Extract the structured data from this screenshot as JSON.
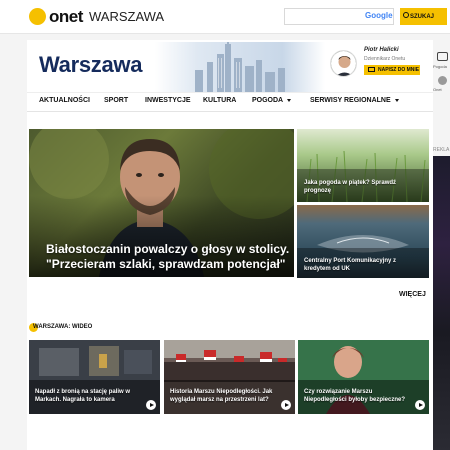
{
  "header": {
    "brand": "onet",
    "section": "WARSZAWA",
    "search": {
      "placeholder": "",
      "provider": "Google",
      "button_label": "SZUKAJ"
    }
  },
  "banner": {
    "title": "Warszawa",
    "editor_name": "Piotr Halicki",
    "editor_role": "Dziennikarz Onetu",
    "write_button": "NAPISZ DO MNIE"
  },
  "side": {
    "label1": "Pogoda",
    "label2": "Onet",
    "ad_label": "REKLA"
  },
  "nav": {
    "items": [
      {
        "label": "AKTUALNOŚCI"
      },
      {
        "label": "SPORT"
      },
      {
        "label": "INWESTYCJE"
      },
      {
        "label": "KULTURA"
      },
      {
        "label": "POGODA"
      },
      {
        "label": "SERWISY REGIONALNE"
      }
    ]
  },
  "hero": {
    "title": "Białostoczanin powalczy o głosy w stolicy. \"Przecieram szlaki, sprawdzam potencjał\""
  },
  "side_cards": [
    {
      "title": "Jaka pogoda w piątek? Sprawdź prognozę"
    },
    {
      "title": "Centralny Port Komunikacyjny z kredytem od UK"
    }
  ],
  "more_label": "WIĘCEJ",
  "video_section": {
    "title": "WARSZAWA: WIDEO",
    "items": [
      {
        "title": "Napadł z bronią na stację paliw w Markach. Nagrała to kamera"
      },
      {
        "title": "Historia Marszu Niepodległości. Jak wyglądał marsz na przestrzeni lat?"
      },
      {
        "title": "Czy rozwiązanie Marszu Niepodległości byłoby bezpieczne?"
      }
    ]
  },
  "colors": {
    "brand_yellow": "#f5c000",
    "title_navy": "#152b5c"
  }
}
